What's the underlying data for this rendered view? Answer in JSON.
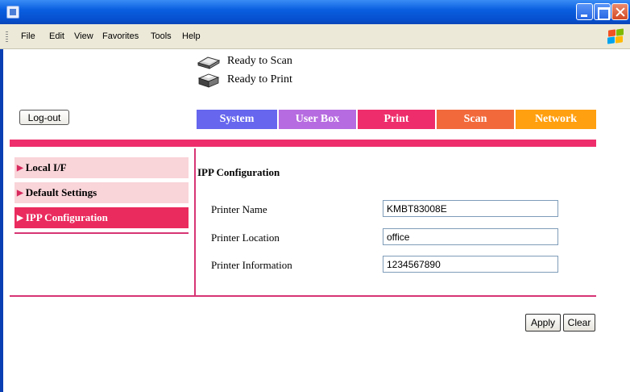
{
  "menu": {
    "items": [
      "File",
      "Edit",
      "View",
      "Favorites",
      "Tools",
      "Help"
    ]
  },
  "status": {
    "scan": "Ready to Scan",
    "print": "Ready to Print",
    "scan_icon": "scanner-icon",
    "print_icon": "printer-icon"
  },
  "logout_label": "Log-out",
  "tabs": [
    {
      "label": "System",
      "color": "#6666ee"
    },
    {
      "label": "User Box",
      "color": "#b66be0"
    },
    {
      "label": "Print",
      "color": "#ee2e6c"
    },
    {
      "label": "Scan",
      "color": "#f26a3c"
    },
    {
      "label": "Network",
      "color": "#ffa010"
    }
  ],
  "sidebar": {
    "items": [
      {
        "label": "Local I/F",
        "active": false
      },
      {
        "label": "Default Settings",
        "active": false
      },
      {
        "label": "IPP Configuration",
        "active": true
      }
    ]
  },
  "section_title": "IPP Configuration",
  "fields": [
    {
      "label": "Printer Name",
      "value": "KMBT83008E"
    },
    {
      "label": "Printer Location",
      "value": "office"
    },
    {
      "label": "Printer Information",
      "value": "1234567890"
    }
  ],
  "buttons": {
    "apply": "Apply",
    "clear": "Clear"
  },
  "colors": {
    "accent_magenta": "#ee2e6c",
    "sidebar_active": "#ea2b5e",
    "sidebar_item": "#f9d4d9"
  }
}
